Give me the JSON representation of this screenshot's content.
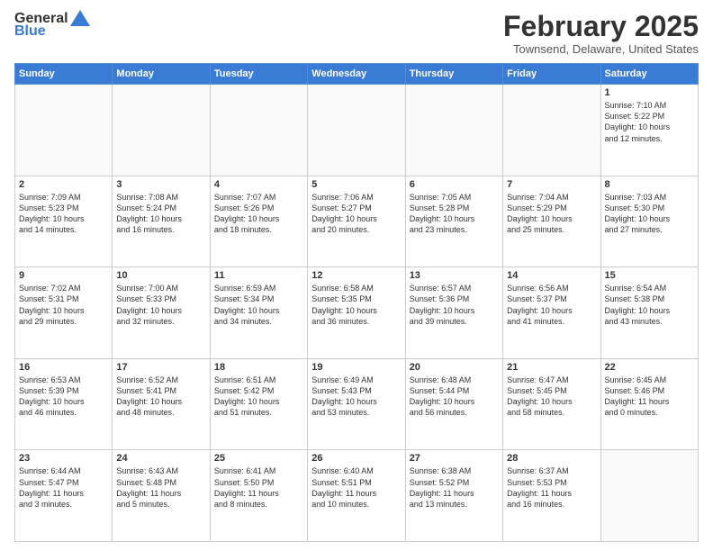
{
  "header": {
    "logo_general": "General",
    "logo_blue": "Blue",
    "month": "February 2025",
    "location": "Townsend, Delaware, United States"
  },
  "weekdays": [
    "Sunday",
    "Monday",
    "Tuesday",
    "Wednesday",
    "Thursday",
    "Friday",
    "Saturday"
  ],
  "weeks": [
    [
      {
        "day": "",
        "info": ""
      },
      {
        "day": "",
        "info": ""
      },
      {
        "day": "",
        "info": ""
      },
      {
        "day": "",
        "info": ""
      },
      {
        "day": "",
        "info": ""
      },
      {
        "day": "",
        "info": ""
      },
      {
        "day": "1",
        "info": "Sunrise: 7:10 AM\nSunset: 5:22 PM\nDaylight: 10 hours\nand 12 minutes."
      }
    ],
    [
      {
        "day": "2",
        "info": "Sunrise: 7:09 AM\nSunset: 5:23 PM\nDaylight: 10 hours\nand 14 minutes."
      },
      {
        "day": "3",
        "info": "Sunrise: 7:08 AM\nSunset: 5:24 PM\nDaylight: 10 hours\nand 16 minutes."
      },
      {
        "day": "4",
        "info": "Sunrise: 7:07 AM\nSunset: 5:26 PM\nDaylight: 10 hours\nand 18 minutes."
      },
      {
        "day": "5",
        "info": "Sunrise: 7:06 AM\nSunset: 5:27 PM\nDaylight: 10 hours\nand 20 minutes."
      },
      {
        "day": "6",
        "info": "Sunrise: 7:05 AM\nSunset: 5:28 PM\nDaylight: 10 hours\nand 23 minutes."
      },
      {
        "day": "7",
        "info": "Sunrise: 7:04 AM\nSunset: 5:29 PM\nDaylight: 10 hours\nand 25 minutes."
      },
      {
        "day": "8",
        "info": "Sunrise: 7:03 AM\nSunset: 5:30 PM\nDaylight: 10 hours\nand 27 minutes."
      }
    ],
    [
      {
        "day": "9",
        "info": "Sunrise: 7:02 AM\nSunset: 5:31 PM\nDaylight: 10 hours\nand 29 minutes."
      },
      {
        "day": "10",
        "info": "Sunrise: 7:00 AM\nSunset: 5:33 PM\nDaylight: 10 hours\nand 32 minutes."
      },
      {
        "day": "11",
        "info": "Sunrise: 6:59 AM\nSunset: 5:34 PM\nDaylight: 10 hours\nand 34 minutes."
      },
      {
        "day": "12",
        "info": "Sunrise: 6:58 AM\nSunset: 5:35 PM\nDaylight: 10 hours\nand 36 minutes."
      },
      {
        "day": "13",
        "info": "Sunrise: 6:57 AM\nSunset: 5:36 PM\nDaylight: 10 hours\nand 39 minutes."
      },
      {
        "day": "14",
        "info": "Sunrise: 6:56 AM\nSunset: 5:37 PM\nDaylight: 10 hours\nand 41 minutes."
      },
      {
        "day": "15",
        "info": "Sunrise: 6:54 AM\nSunset: 5:38 PM\nDaylight: 10 hours\nand 43 minutes."
      }
    ],
    [
      {
        "day": "16",
        "info": "Sunrise: 6:53 AM\nSunset: 5:39 PM\nDaylight: 10 hours\nand 46 minutes."
      },
      {
        "day": "17",
        "info": "Sunrise: 6:52 AM\nSunset: 5:41 PM\nDaylight: 10 hours\nand 48 minutes."
      },
      {
        "day": "18",
        "info": "Sunrise: 6:51 AM\nSunset: 5:42 PM\nDaylight: 10 hours\nand 51 minutes."
      },
      {
        "day": "19",
        "info": "Sunrise: 6:49 AM\nSunset: 5:43 PM\nDaylight: 10 hours\nand 53 minutes."
      },
      {
        "day": "20",
        "info": "Sunrise: 6:48 AM\nSunset: 5:44 PM\nDaylight: 10 hours\nand 56 minutes."
      },
      {
        "day": "21",
        "info": "Sunrise: 6:47 AM\nSunset: 5:45 PM\nDaylight: 10 hours\nand 58 minutes."
      },
      {
        "day": "22",
        "info": "Sunrise: 6:45 AM\nSunset: 5:46 PM\nDaylight: 11 hours\nand 0 minutes."
      }
    ],
    [
      {
        "day": "23",
        "info": "Sunrise: 6:44 AM\nSunset: 5:47 PM\nDaylight: 11 hours\nand 3 minutes."
      },
      {
        "day": "24",
        "info": "Sunrise: 6:43 AM\nSunset: 5:48 PM\nDaylight: 11 hours\nand 5 minutes."
      },
      {
        "day": "25",
        "info": "Sunrise: 6:41 AM\nSunset: 5:50 PM\nDaylight: 11 hours\nand 8 minutes."
      },
      {
        "day": "26",
        "info": "Sunrise: 6:40 AM\nSunset: 5:51 PM\nDaylight: 11 hours\nand 10 minutes."
      },
      {
        "day": "27",
        "info": "Sunrise: 6:38 AM\nSunset: 5:52 PM\nDaylight: 11 hours\nand 13 minutes."
      },
      {
        "day": "28",
        "info": "Sunrise: 6:37 AM\nSunset: 5:53 PM\nDaylight: 11 hours\nand 16 minutes."
      },
      {
        "day": "",
        "info": ""
      }
    ]
  ]
}
